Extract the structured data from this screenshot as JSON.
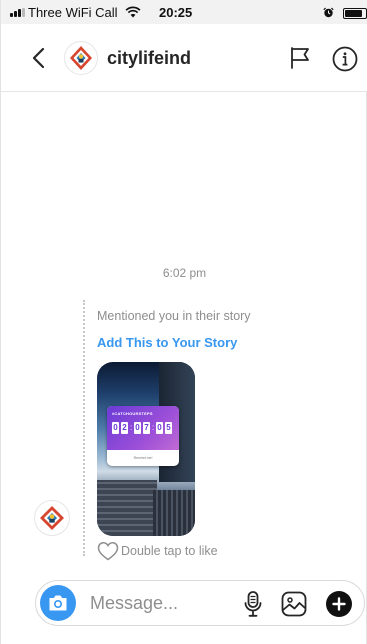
{
  "status_bar": {
    "carrier": "Three WiFi Call",
    "time": "20:25",
    "icons": [
      "signal-icon",
      "wifi-icon",
      "alarm-icon",
      "battery-icon"
    ]
  },
  "header": {
    "title": "citylifeind",
    "icons": [
      "back-icon",
      "avatar",
      "flag-icon",
      "info-icon"
    ]
  },
  "conversation": {
    "timestamp": "6:02 pm",
    "mention_text": "Mentioned you in their story",
    "add_story_link": "Add This to Your Story",
    "story_sticker": {
      "label": "#CATCHOURSTEPS",
      "digits": [
        "0",
        "2",
        "0",
        "7",
        "0",
        "5"
      ],
      "footer": "Remind me!"
    },
    "like_hint": "Double tap to like"
  },
  "composer": {
    "placeholder": "Message...",
    "icons": [
      "camera-icon",
      "microphone-icon",
      "gallery-icon",
      "plus-icon"
    ]
  },
  "colors": {
    "accent_blue": "#3897f0",
    "text_primary": "#262626",
    "text_secondary": "#8e8e8e",
    "border": "#dbdbdb"
  }
}
